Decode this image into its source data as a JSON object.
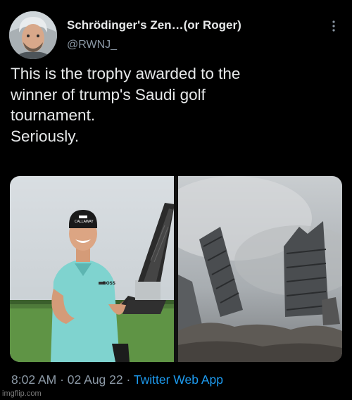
{
  "author": {
    "display_name": "Schrödinger's Zen…(or Roger)",
    "handle": "@RWNJ_"
  },
  "tweet": {
    "lines": [
      "This is the trophy awarded to the",
      "winner of trump's Saudi golf",
      "tournament.",
      "Seriously."
    ]
  },
  "media": [
    {
      "icon": "golfer-with-trophy-photo",
      "cap_text": "CALLAWAY",
      "shirt_text": "BOSS"
    },
    {
      "icon": "ruined-building-photo"
    }
  ],
  "meta": {
    "time": "8:02 AM",
    "sep1": " · ",
    "date": "02 Aug 22",
    "sep2": " · ",
    "source": "Twitter Web App"
  },
  "watermark": "imgflip.com",
  "colors": {
    "background": "#000000",
    "text": "#e7e9ea",
    "secondary": "#8b98a5",
    "link": "#1d9bf0"
  }
}
